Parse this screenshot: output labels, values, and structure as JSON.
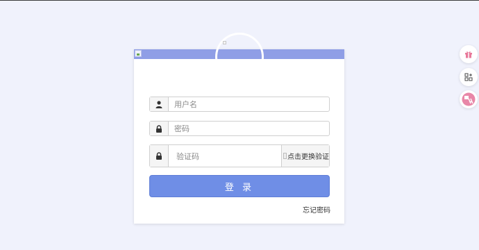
{
  "login_form": {
    "username_placeholder": "用户名",
    "password_placeholder": "密码",
    "captcha_placeholder": "验证码",
    "captcha_image_alt": "点击更换验证",
    "login_label": "登 录",
    "forgot_password": "忘记密码"
  },
  "side_toolbar": {
    "items": [
      "gift-icon",
      "apps-add-icon",
      "translate-icon"
    ]
  },
  "colors": {
    "header": "#8f9ee6",
    "primary_button": "#6f8ee6",
    "background": "#f0f2fc"
  }
}
